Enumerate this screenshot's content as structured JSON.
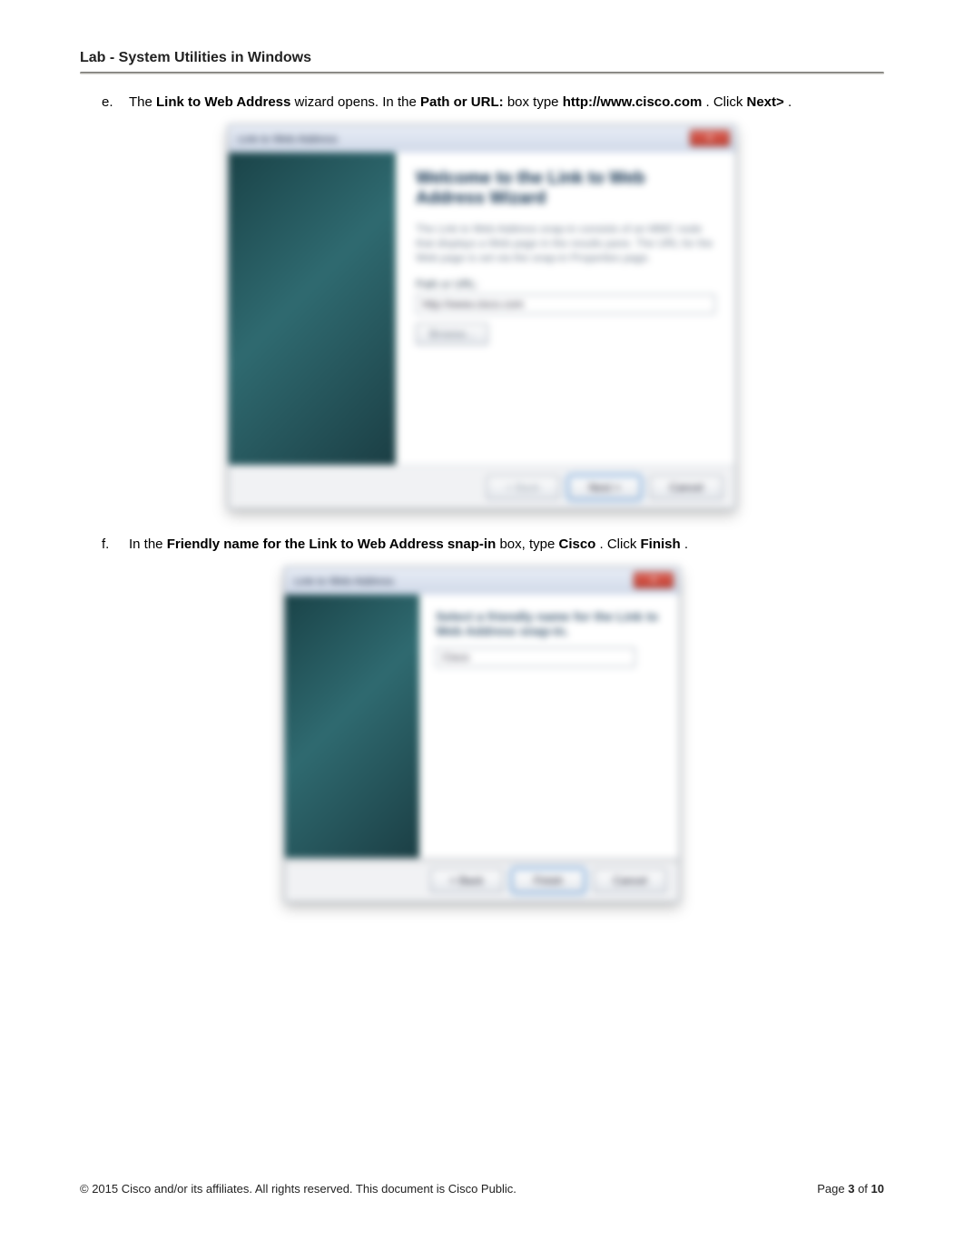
{
  "doc": {
    "title": "Lab - System Utilities in Windows"
  },
  "steps": {
    "e": {
      "marker": "e.",
      "t1": "The ",
      "b1": "Link to Web Address",
      "t2": " wizard opens. In the   ",
      "b2": "Path or URL:",
      "t3": " box type ",
      "b3": "http://www.cisco.com",
      "t4": ". Click ",
      "b4": "Next>",
      "t5": "."
    },
    "f": {
      "marker": "f.",
      "t1": "In the ",
      "b1": "Friendly name for the Link to Web Address snap-in",
      "t2": " box, type ",
      "b2": "Cisco",
      "t3": ". Click ",
      "b3": "Finish",
      "t4": "."
    }
  },
  "dialog1": {
    "title": "Link to Web Address",
    "close": "X",
    "heading": "Welcome to the Link to Web Address Wizard",
    "para": "The Link to Web Address snap-in consists of an MMC node that displays a Web page in the results pane. The URL for the Web page is set via the snap-in Properties page.",
    "label": "Path or URL:",
    "url_value": "http://www.cisco.com",
    "browse": "Browse...",
    "back": "< Back",
    "next": "Next >",
    "cancel": "Cancel"
  },
  "dialog2": {
    "title": "Link to Web Address",
    "close": "X",
    "heading": "Select a friendly name for the Link to Web Address snap-in.",
    "input_value": "Cisco",
    "back": "< Back",
    "finish": "Finish",
    "cancel": "Cancel"
  },
  "footer": {
    "copyright": "© 2015 Cisco and/or its affiliates. All rights reserved. This document is Cisco Public.",
    "page_label": "Page ",
    "page_current": "3",
    "page_of": " of ",
    "page_total": "10"
  }
}
